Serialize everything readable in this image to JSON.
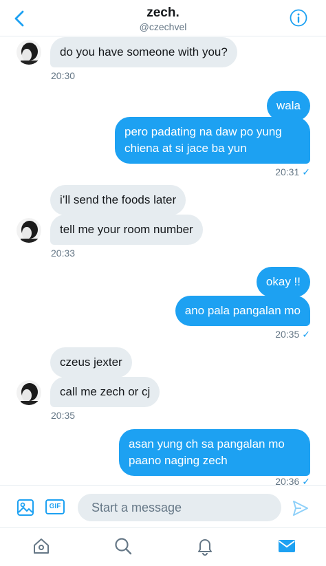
{
  "header": {
    "title": "zech.",
    "handle": "@czechvel"
  },
  "messages": {
    "m1": "do you have someone with you?",
    "t1": "20:30",
    "m2": "wala",
    "m3_l1": "pero padating na daw po yung",
    "m3_l2": "chiena at si jace ba yun",
    "t2": "20:31",
    "m4": "i’ll send the foods later",
    "m5": "tell me your room number",
    "t3": "20:33",
    "m6": "okay !!",
    "m7": "ano pala pangalan mo",
    "t4": "20:35",
    "m8": "czeus jexter",
    "m9": "call me zech or cj",
    "t5": "20:35",
    "m10_l1": "asan yung ch sa pangalan mo",
    "m10_l2": "paano naging zech",
    "t6": "20:36",
    "check": "✓"
  },
  "composer": {
    "placeholder": "Start a message",
    "gif_label": "GIF"
  },
  "colors": {
    "accent": "#1da1f2",
    "incoming": "#e6ecf0",
    "muted": "#657786"
  },
  "icons": [
    "back-chevron-icon",
    "info-icon",
    "image-icon",
    "gif-icon",
    "send-icon",
    "home-icon",
    "search-icon",
    "notifications-icon",
    "messages-icon"
  ]
}
